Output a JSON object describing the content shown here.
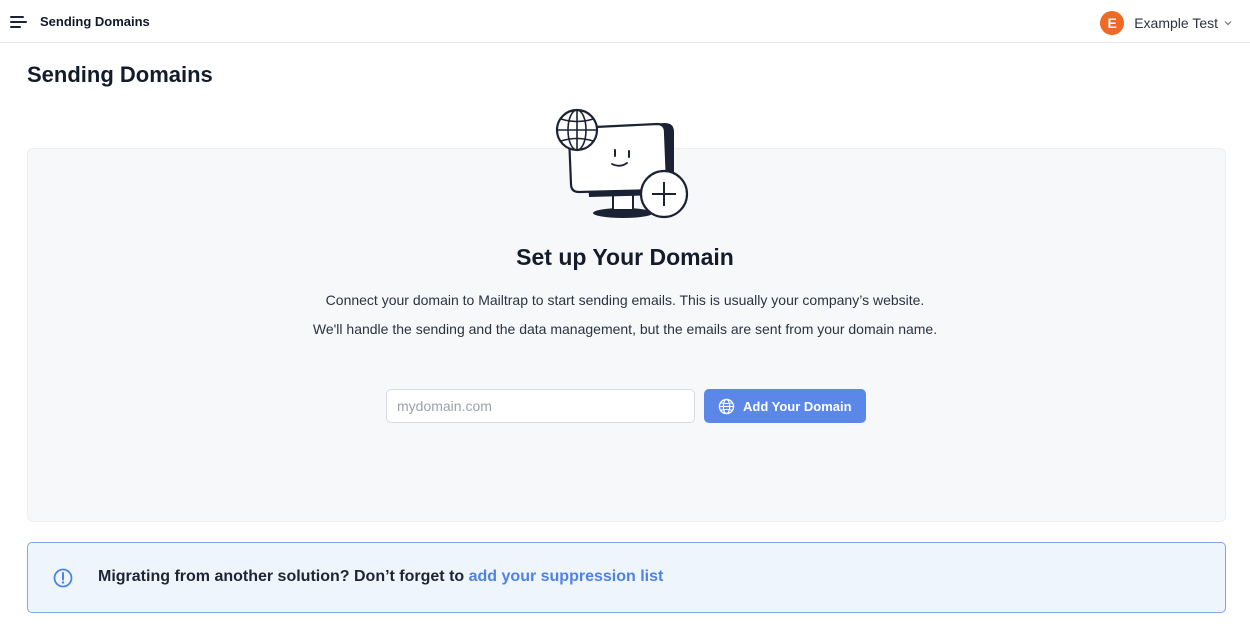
{
  "header": {
    "title": "Sending Domains",
    "menu_icon": "hamburger-menu-icon",
    "user": {
      "avatar_letter": "E",
      "avatar_color": "#ee6a24",
      "name": "Example Test",
      "dropdown_icon": "chevron-down-icon"
    }
  },
  "page": {
    "title": "Sending Domains"
  },
  "setup": {
    "illustration_icon": "monitor-globe-plus-illustration",
    "title": "Set up Your Domain",
    "description_line1": "Connect your domain to Mailtrap to start sending emails. This is usually your company’s website.",
    "description_line2": "We'll handle the sending and the data management, but the emails are sent from your domain name.",
    "input": {
      "placeholder": "mydomain.com",
      "value": ""
    },
    "button": {
      "label": "Add Your Domain",
      "icon": "globe-icon",
      "color": "#5a87e8"
    }
  },
  "notice": {
    "icon": "info-circle-icon",
    "text": "Migrating from another solution? Don’t forget to ",
    "link_text": "add your suppression list",
    "link_color": "#4f82e6"
  }
}
